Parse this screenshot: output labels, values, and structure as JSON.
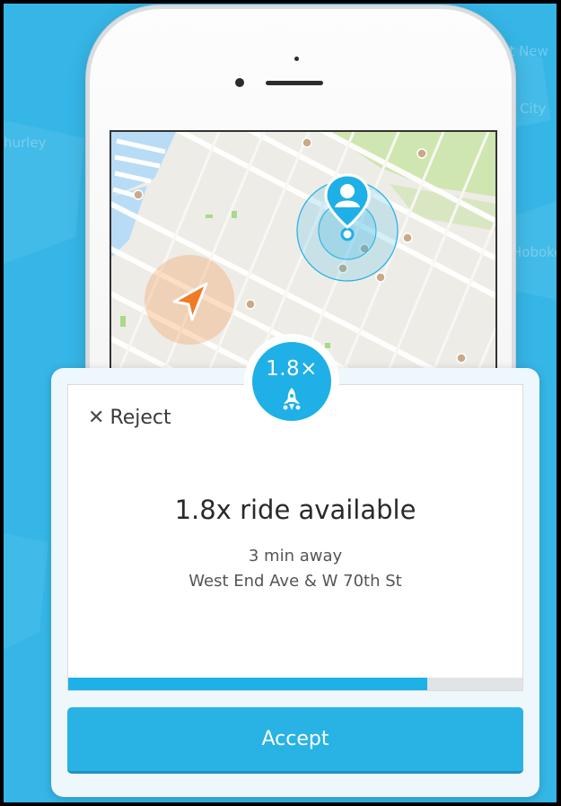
{
  "background": {
    "color": "#35b6e7",
    "map_labels": [
      "Fort New York",
      "City",
      "Hoboke",
      "hurley"
    ]
  },
  "map": {
    "driver_marker": "navigation-arrow-icon",
    "passenger_marker": "person-pin-icon",
    "accent_orange": "#f28c3a",
    "accent_blue": "#1eb0e6"
  },
  "surge_badge": {
    "label": "1.8×",
    "icon": "rocket-icon"
  },
  "request": {
    "reject_label": "Reject",
    "title": "1.8x ride available",
    "eta": "3 min away",
    "address": "West End Ave & W 70th St",
    "progress": 0.79
  },
  "actions": {
    "accept_label": "Accept",
    "accept_color": "#29b3e5"
  }
}
